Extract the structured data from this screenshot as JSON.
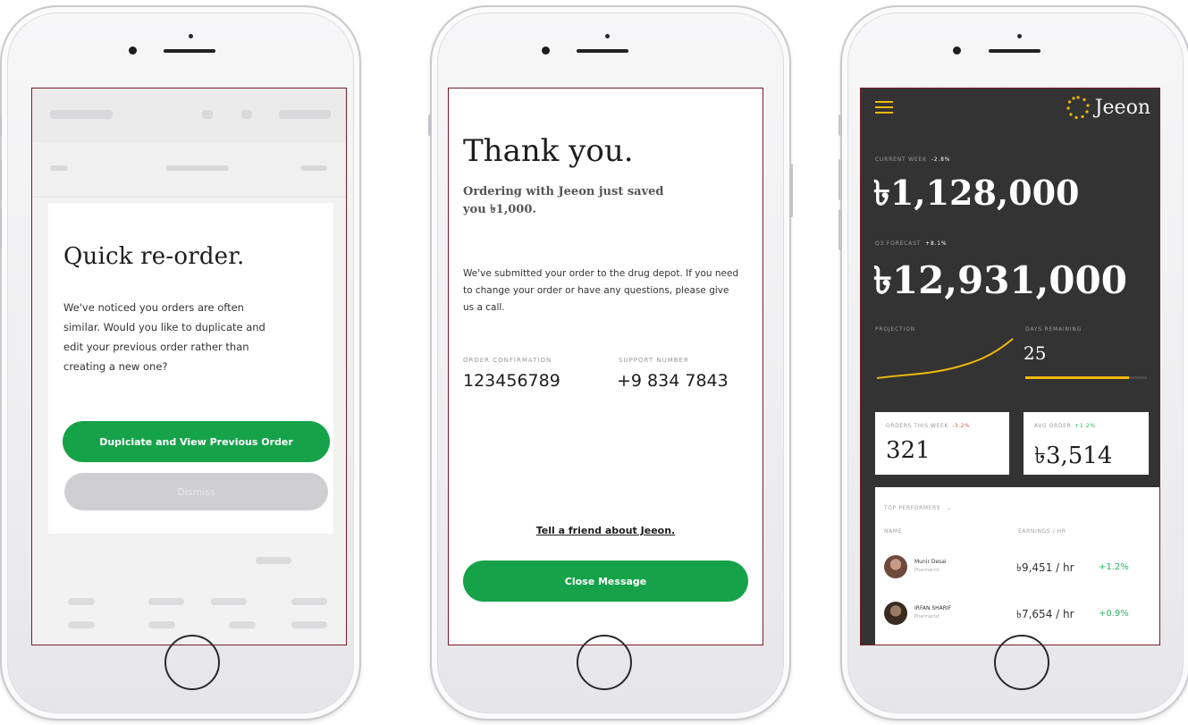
{
  "phone1": {
    "modal_title": "Quick re-order.",
    "modal_body": "We've noticed you orders are often similar. Would you like to duplicate and edit your previous order rather than creating a new one?",
    "primary_button": "Duplciate and View Previous Order",
    "secondary_button": "Dismiss"
  },
  "phone2": {
    "title": "Thank you.",
    "subtitle": "Ordering with Jeeon just saved you ৳1,000.",
    "body": "We've submitted your order to the drug depot. If you need to change your order or have any questions, please give us a call.",
    "order_confirmation_label": "Order Confirmation",
    "order_confirmation_value": "123456789",
    "support_label": "Support Number",
    "support_value": "+9 834 7843",
    "share_link": "Tell a friend about Jeeon.",
    "close_button": "Close Message"
  },
  "phone3": {
    "brand": "Jeeon",
    "current_week_label": "Current Week",
    "current_week_change": "-2.8%",
    "current_week_value": "৳1,128,000",
    "q3_forecast_label": "Q3 Forecast",
    "q3_forecast_change": "+8.1%",
    "q3_forecast_value": "৳12,931,000",
    "projection_label": "Projection",
    "days_remaining_label": "Days Remaining",
    "days_remaining_value": "25",
    "days_remaining_progress": 0.85,
    "orders_label": "Orders This Week",
    "orders_change": "-3.2%",
    "orders_value": "321",
    "avg_order_label": "Avg Order",
    "avg_order_change": "+1.2%",
    "avg_order_value": "৳3,514",
    "performers_label": "Top Performers",
    "col_name": "Name",
    "col_rate": "Earnings / hr",
    "performers": [
      {
        "name": "Munir Desai",
        "sub": "Pharmacist",
        "value": "৳9,451 / hr",
        "change": "+1.2%"
      },
      {
        "name": "IRFAN SHARIF",
        "sub": "Pharmacist",
        "value": "৳7,654 / hr",
        "change": "+0.9%"
      }
    ],
    "colors": {
      "accent": "#f0b90b",
      "green": "#16a249",
      "dark": "#333333",
      "positive": "#2fb36a",
      "negative": "#d9534f"
    }
  }
}
